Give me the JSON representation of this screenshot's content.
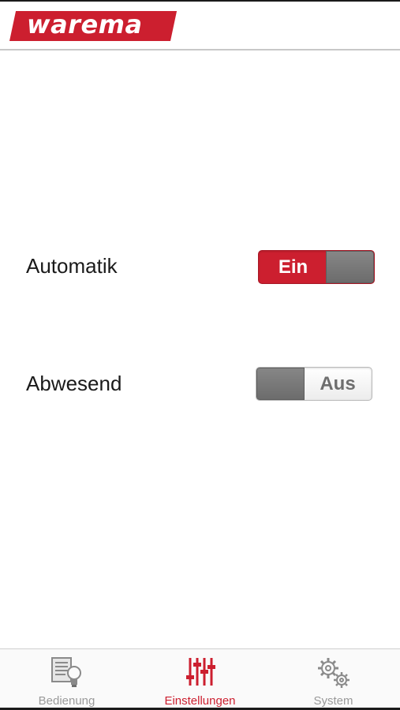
{
  "header": {
    "logo_text": "warema"
  },
  "settings": {
    "automatik": {
      "label": "Automatik",
      "state_label": "Ein",
      "on": true
    },
    "abwesend": {
      "label": "Abwesend",
      "state_label": "Aus",
      "on": false
    }
  },
  "tabbar": {
    "tabs": [
      {
        "label": "Bedienung",
        "icon": "manual-control-icon",
        "active": false
      },
      {
        "label": "Einstellungen",
        "icon": "sliders-icon",
        "active": true
      },
      {
        "label": "System",
        "icon": "gears-icon",
        "active": false
      }
    ]
  },
  "colors": {
    "brand_red": "#cc1f2f",
    "inactive_gray": "#9a9a9a",
    "knob_gray": "#777777"
  }
}
